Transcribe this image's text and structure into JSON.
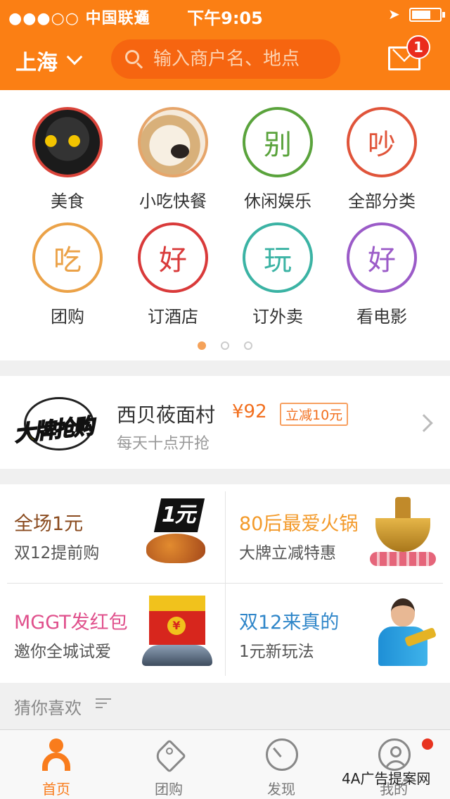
{
  "status_bar": {
    "signal": "●●●○○ 中国联通",
    "time": "下午9:05"
  },
  "header": {
    "city": "上海",
    "search_placeholder": "输入商户名、地点",
    "message_badge": "1"
  },
  "categories": [
    {
      "label": "美食",
      "glyph": "",
      "color": "#d9443a",
      "icon": "cat-photo-icon"
    },
    {
      "label": "小吃快餐",
      "glyph": "",
      "color": "#e6a56a",
      "icon": "dog-photo-icon"
    },
    {
      "label": "休闲娱乐",
      "glyph": "别",
      "color": "#5aa33c",
      "icon": "bie-icon"
    },
    {
      "label": "全部分类",
      "glyph": "吵",
      "color": "#e0543a",
      "icon": "chao-icon"
    },
    {
      "label": "团购",
      "glyph": "吃",
      "color": "#eba248",
      "icon": "chi-icon"
    },
    {
      "label": "订酒店",
      "glyph": "好",
      "color": "#d93a3a",
      "icon": "hao-icon"
    },
    {
      "label": "订外卖",
      "glyph": "玩",
      "color": "#3bb3a4",
      "icon": "wan-icon"
    },
    {
      "label": "看电影",
      "glyph": "好",
      "color": "#9b5bc8",
      "icon": "hao-purple-icon"
    }
  ],
  "carousel": {
    "pages": 3,
    "active": 1
  },
  "promo": {
    "logo_text": "大牌抢购",
    "title": "西贝莜面村",
    "price": "¥92",
    "tag": "立减10元",
    "subtitle": "每天十点开抢"
  },
  "deals": [
    {
      "title": "全场1元",
      "subtitle": "双12提前购",
      "title_color": "#8a4b1f",
      "art_text": "1元"
    },
    {
      "title": "80后最爱火锅",
      "subtitle": "大牌立减特惠",
      "title_color": "#f39a2a",
      "art_text": ""
    },
    {
      "title": "MGGT发红包",
      "subtitle": "邀你全城试爱",
      "title_color": "#e0508c",
      "art_text": "¥"
    },
    {
      "title": "双12来真的",
      "subtitle": "1元新玩法",
      "title_color": "#2f86c9",
      "art_text": ""
    }
  ],
  "guess": {
    "label": "猜你喜欢"
  },
  "tabs": [
    {
      "label": "首页",
      "icon": "home-icon",
      "active": true
    },
    {
      "label": "团购",
      "icon": "tag-icon",
      "active": false
    },
    {
      "label": "发现",
      "icon": "discover-icon",
      "active": false
    },
    {
      "label": "我的",
      "icon": "profile-icon",
      "active": false
    }
  ],
  "watermark": "4A广告提案网",
  "colors": {
    "brand": "#fb7f14",
    "accent_text": "#f97c1c"
  }
}
